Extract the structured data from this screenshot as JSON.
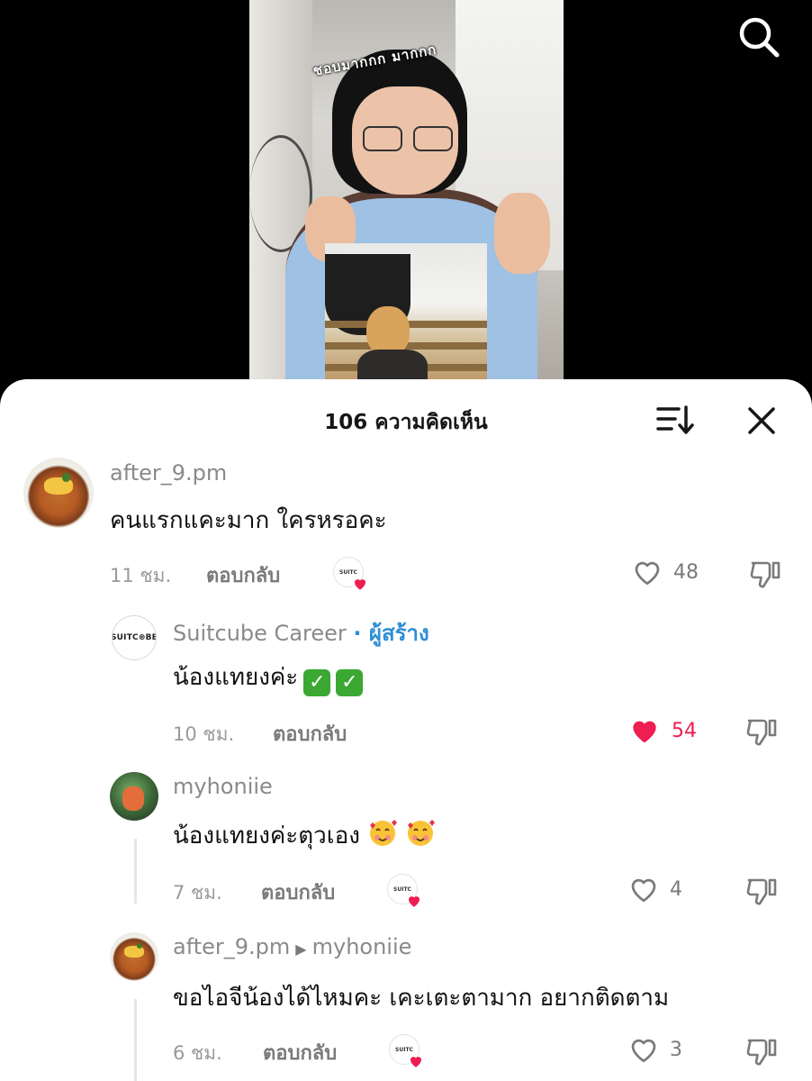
{
  "video": {
    "sticker_text": "ชอบมากกก มากกก"
  },
  "header": {
    "title": "106 ความคิดเห็น"
  },
  "comments": [
    {
      "username": "after_9.pm",
      "text": "คนแรกแคะมาก ใครหรอคะ",
      "time": "11 ชม.",
      "reply_label": "ตอบกลับ",
      "likes": "48",
      "liked": false,
      "creator_liked": true
    },
    {
      "username": "Suitcube Career",
      "creator_badge": "· ผู้สร้าง",
      "avatar_text": "SUITC⊛BE",
      "text": "น้องแทยงค่ะ",
      "time": "10 ชม.",
      "reply_label": "ตอบกลับ",
      "likes": "54",
      "liked": true
    },
    {
      "username": "myhoniie",
      "text": "น้องแทยงค่ะตุวเอง",
      "time": "7 ชม.",
      "reply_label": "ตอบกลับ",
      "likes": "4",
      "liked": false,
      "creator_liked": true
    },
    {
      "username": "after_9.pm",
      "reply_to": "myhoniie",
      "text": "ขอไอจีน้องได้ไหมคะ เคะเตะตามาก อยากติดตาม",
      "time": "6 ชม.",
      "reply_label": "ตอบกลับ",
      "likes": "3",
      "liked": false,
      "creator_liked": true
    }
  ],
  "creator_mini_avatar_text": "SUITC",
  "icons": {
    "search": "search-icon",
    "sort": "sort-icon",
    "close": "close-icon",
    "like": "heart-icon",
    "dislike": "thumbs-down-icon"
  },
  "colors": {
    "like_active": "#ee1d52",
    "creator_badge": "#2d8fd5"
  }
}
